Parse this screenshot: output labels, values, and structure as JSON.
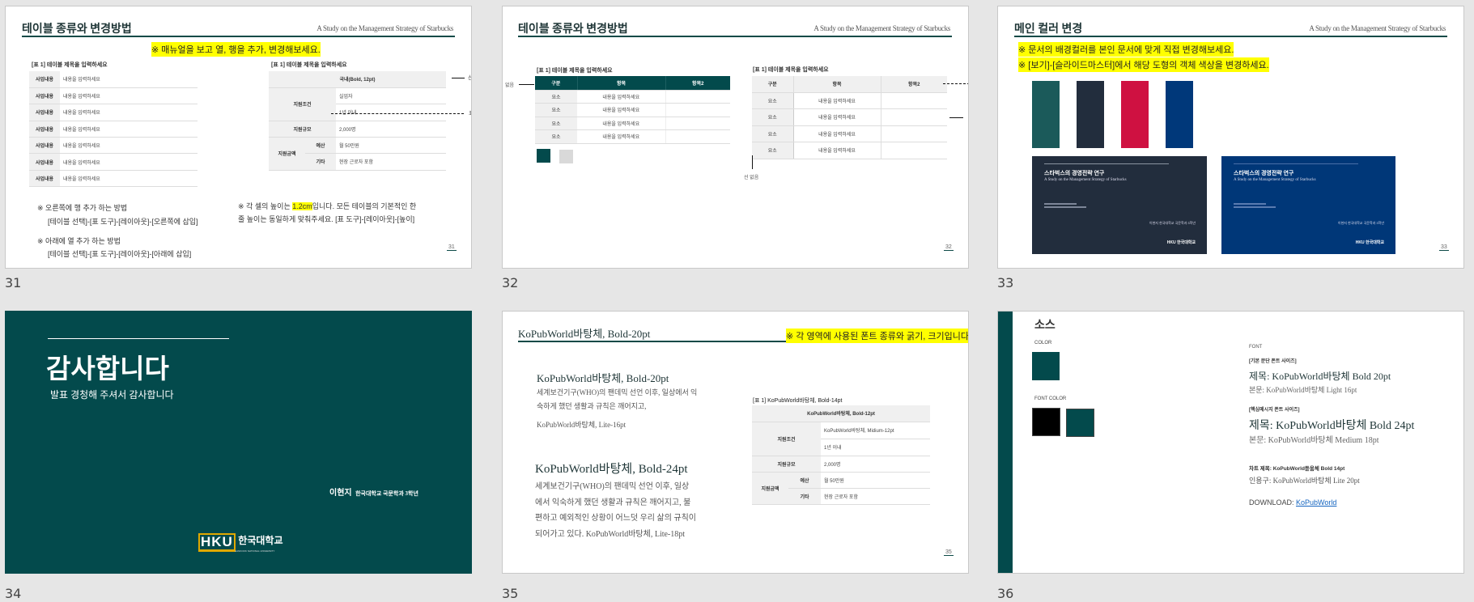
{
  "slides": [
    {
      "number": "31",
      "title": "테이블 종류와 변경방법",
      "subtitle": "A Study on the Management Strategy of Starbucks",
      "highlight": "※ 매뉴얼을 보고 열, 행을 추가, 변경해보세요.",
      "table1": {
        "caption": "[표 1] 테이블 제목을 입력하세요",
        "rows": [
          [
            "사업내용",
            "내용을 입력하세요"
          ],
          [
            "사업내용",
            "내용을 입력하세요"
          ],
          [
            "사업내용",
            "내용을 입력하세요"
          ],
          [
            "사업내용",
            "내용을 입력하세요"
          ],
          [
            "사업내용",
            "내용을 입력하세요"
          ],
          [
            "사업내용",
            "내용을 입력하세요"
          ],
          [
            "사업내용",
            "내용을 입력하세요"
          ]
        ]
      },
      "table2": {
        "caption": "[표 1] 테이블 제목을 입력하세요",
        "header": "국내(Bold, 12pt)",
        "cond_label": "지원조건",
        "cond_values": [
          "실업자",
          "1년 이내"
        ],
        "scale_label": "지원규모",
        "scale_value": "2,000명",
        "amount_label": "지원금액",
        "amount_rows": [
          [
            "예산",
            "월 50만원"
          ],
          [
            "기타",
            "현장 근로자 포함"
          ]
        ]
      },
      "arrow_labels": [
        "선",
        "표"
      ],
      "notes_left": [
        "※ 오른쪽에 행 추가 하는 방법",
        "[테이블 선택]-[표 도구]-[레이아웃]-[오른쪽에 삽입]",
        "※ 아래에 열 추가 하는 방법",
        "[테이블 선택]-[표 도구]-[레이아웃]-[아래에 삽입]"
      ],
      "notes_right": {
        "pre": "※ 각 셀의 높이는 ",
        "mark": "1.2cm",
        "post": "입니다. 모든 테이블의 기본적인 한",
        "line2": "줄 높이는 동일하게 맞춰주세요. [표 도구]-[레이아웃]-[높이]"
      }
    },
    {
      "number": "32",
      "title": "테이블 종류와 변경방법",
      "subtitle": "A Study on the Management Strategy of Starbucks",
      "tableA": {
        "caption": "[표 1] 테이블 제목을 입력하세요",
        "headers": [
          "구분",
          "항목",
          "항목2"
        ],
        "rows": [
          [
            "요소",
            "내용을 입력하세요",
            ""
          ],
          [
            "요소",
            "내용을 입력하세요",
            ""
          ],
          [
            "요소",
            "내용을 입력하세요",
            ""
          ],
          [
            "요소",
            "내용을 입력하세요",
            ""
          ]
        ]
      },
      "tableB": {
        "caption": "[표 1] 테이블 제목을 입력하세요",
        "headers": [
          "구분",
          "항목",
          "항목2"
        ],
        "rows": [
          [
            "요소",
            "내용을 입력하세요",
            ""
          ],
          [
            "요소",
            "내용을 입력하세요",
            ""
          ],
          [
            "요소",
            "내용을 입력하세요",
            ""
          ],
          [
            "요소",
            "내용을 입력하세요",
            ""
          ]
        ]
      },
      "label_none": "없음",
      "label_no_line": "선 없음",
      "swatches": [
        "#034a4c",
        "#d9d9d9"
      ]
    },
    {
      "number": "33",
      "title": "메인 컬러 변경",
      "subtitle": "A Study on the Management Strategy of Starbucks",
      "highlights": [
        "※ 문서의 배경컬러를 본인 문서에 맞게 직접 변경해보세요.",
        "※ [보기]-[슬라이드마스터]에서 해당 도형의 객체 색상을 변경하세요."
      ],
      "swatches": [
        "#1b5a5a",
        "#222d3d",
        "#cf1141",
        "#00387a"
      ],
      "covers": [
        {
          "bg": "#222d3d",
          "title": "스타벅스의 경영전략 연구",
          "subtitle": "A Study on the Management Strategy of Starbucks",
          "author": "이현지 한국대학교 국문학과 3학년",
          "logo": "HKU 한국대학교"
        },
        {
          "bg": "#003778",
          "title": "스타벅스의 경영전략 연구",
          "subtitle": "A Study on the Management Strategy of Starbucks",
          "author": "이현지 한국대학교 국문학과 3학년",
          "logo": "HKU 한국대학교"
        }
      ]
    },
    {
      "number": "34",
      "bg": "#034a4c",
      "title": "감사합니다",
      "subtitle": "발표 경청해 주셔서 감사합니다",
      "author": "이현지",
      "affiliation": "한국대학교 국문학과 3학년",
      "logo_mark": "HKU",
      "logo_text": "한국대학교",
      "logo_sub": "HANKOOK NATIONAL UNIVERSITY"
    },
    {
      "number": "35",
      "title": "KoPubWorld바탕체, Bold-20pt",
      "highlight": "※ 각 영역에 사용된 폰트 종류와 굵기, 크기입니다.",
      "block1": {
        "heading": "KoPubWorld바탕체, Bold-20pt",
        "lines": [
          "세계보건기구(WHO)의 팬데믹 선언 이후,  일상에서 익",
          "숙하게 했던 생활과 규칙은 깨어지고,"
        ],
        "note": "KoPubWorld바탕체, Lite-16pt"
      },
      "block2": {
        "heading": "KoPubWorld바탕체, Bold-24pt",
        "lines": [
          "세계보건기구(WHO)의 팬데믹 선언 이후,  일상",
          "에서 익숙하게 했던 생활과 규칙은 깨어지고, 불",
          "편하고 예외적인 상황이 어느덧 우리 삶의 규칙이",
          "되어가고 있다. KoPubWorld바탕체, Lite-18pt"
        ]
      },
      "table": {
        "caption": "[표 1] KoPubWorld바탕체, Bold-14pt",
        "header": "KoPubWorld바탕체, Bold-12pt",
        "cond_label": "지원조건",
        "cond_values": [
          "KoPubWorld바탕체, Midium-12pt",
          "1년 이내"
        ],
        "scale_label": "지원규모",
        "scale_value": "2,000명",
        "amount_label": "지원금액",
        "amount_rows": [
          [
            "예산",
            "월 50만원"
          ],
          [
            "기타",
            "현장 근로자 포함"
          ]
        ]
      }
    },
    {
      "number": "36",
      "title": "소스",
      "color_label": "COLOR",
      "color": "#034a4c",
      "font_color_label": "FONT COLOR",
      "font_colors": [
        "#000000",
        "#034a4c"
      ],
      "font_label": "FONT",
      "basic_label": "[기본 문단 폰트 사이즈]",
      "basic_title": "제목: KoPubWorld바탕체 Bold 20pt",
      "basic_body": "본문: KoPubWorld바탕체 Light 16pt",
      "key_label": "[핵심메시지 폰트 사이즈]",
      "key_title": "제목: KoPubWorld바탕체 Bold 24pt",
      "key_body": "본문: KoPubWorld바탕체 Medium 18pt",
      "chart_title": "차트 제목: KoPubWorld돋움체 Bold 14pt",
      "quote": "인용구: KoPubWorld바탕체 Lite 20pt",
      "download_label": "DOWNLOAD:",
      "download_link": "KoPubWorld"
    }
  ]
}
